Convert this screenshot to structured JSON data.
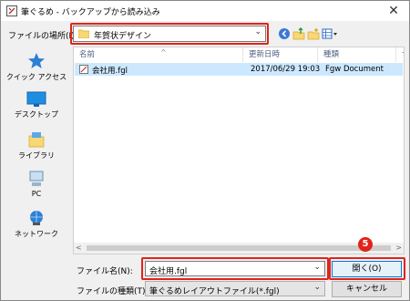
{
  "window": {
    "title": "筆ぐるめ - バックアップから読み込み",
    "close_glyph": "✕"
  },
  "location": {
    "label": "ファイルの場所(I):",
    "value": "年賀状デザイン"
  },
  "nav": {
    "items": [
      {
        "label": "クイック アクセス",
        "icon": "star-icon"
      },
      {
        "label": "デスクトップ",
        "icon": "desktop-icon"
      },
      {
        "label": "ライブラリ",
        "icon": "library-icon"
      },
      {
        "label": "PC",
        "icon": "computer-icon"
      },
      {
        "label": "ネットワーク",
        "icon": "network-icon"
      }
    ]
  },
  "file_list": {
    "columns": [
      "名前",
      "更新日時",
      "種類",
      "サ"
    ],
    "rows": [
      {
        "name": "会社用.fgl",
        "modified": "2017/06/29 19:03",
        "type": "Fgw Document"
      }
    ]
  },
  "footer": {
    "filename_label": "ファイル名(N):",
    "filename_value": "会社用.fgl",
    "filetype_label": "ファイルの種類(T):",
    "filetype_value": "筆ぐるめレイアウトファイル(*.fgl)",
    "open_label": "開く(O)",
    "cancel_label": "キャンセル"
  },
  "annotation": {
    "step_number": "5"
  },
  "colors": {
    "highlight": "#e2231a",
    "selected_row": "#cce8ff",
    "accent": "#0078d7"
  }
}
